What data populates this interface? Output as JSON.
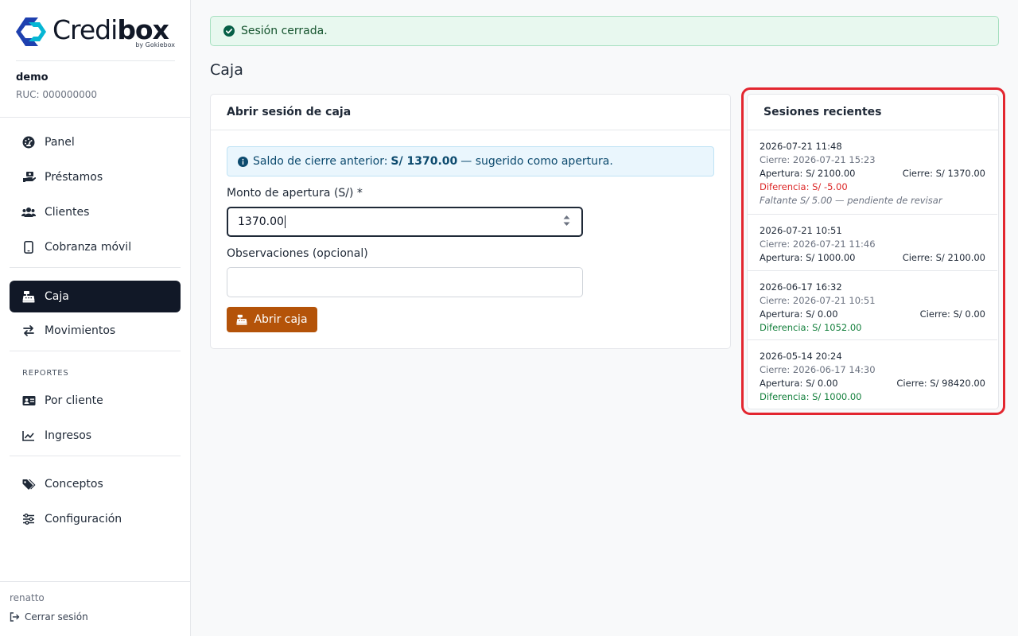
{
  "brand": {
    "name_light": "Credi",
    "name_bold": "box",
    "byline": "by Gokiebox"
  },
  "org": {
    "name": "demo",
    "ruc": "RUC: 000000000"
  },
  "nav": {
    "panel": "Panel",
    "loans": "Préstamos",
    "clients": "Clientes",
    "mobile": "Cobranza móvil",
    "cash": "Caja",
    "movements": "Movimientos",
    "reports_label": "REPORTES",
    "by_client": "Por cliente",
    "income": "Ingresos",
    "concepts": "Conceptos",
    "settings": "Configuración"
  },
  "user": {
    "name": "renatto",
    "logout": "Cerrar sesión"
  },
  "alert": {
    "message": "Sesión cerrada."
  },
  "page": {
    "title": "Caja"
  },
  "open_form": {
    "header": "Abrir sesión de caja",
    "info_prefix": "Saldo de cierre anterior:",
    "info_amount": "S/ 1370.00",
    "info_suffix": "— sugerido como apertura.",
    "amount_label": "Monto de apertura (S/) *",
    "amount_value": "1370.00",
    "notes_label": "Observaciones (opcional)",
    "notes_value": "",
    "submit": "Abrir caja"
  },
  "sessions": {
    "header": "Sesiones recientes",
    "items": [
      {
        "opened": "2026-07-21 11:48",
        "closed": "Cierre: 2026-07-21 15:23",
        "apertura": "Apertura: S/ 2100.00",
        "cierre": "Cierre: S/ 1370.00",
        "diff": "Diferencia: S/ -5.00",
        "note": "Faltante S/ 5.00 — pendiente de revisar"
      },
      {
        "opened": "2026-07-21 10:51",
        "closed": "Cierre: 2026-07-21 11:46",
        "apertura": "Apertura: S/ 1000.00",
        "cierre": "Cierre: S/ 2100.00"
      },
      {
        "opened": "2026-06-17 16:32",
        "closed": "Cierre: 2026-07-21 10:51",
        "apertura": "Apertura: S/ 0.00",
        "cierre": "Cierre: S/ 0.00",
        "diff": "Diferencia: S/ 1052.00"
      },
      {
        "opened": "2026-05-14 20:24",
        "closed": "Cierre: 2026-06-17 14:30",
        "apertura": "Apertura: S/ 0.00",
        "cierre": "Cierre: S/ 98420.00",
        "diff": "Diferencia: S/ 1000.00"
      }
    ]
  },
  "colors": {
    "brand_blue": "#1e40af",
    "brand_cyan": "#06b6d4",
    "accent": "#b45309",
    "highlight": "#e3262f",
    "negative": "#dc2626",
    "positive": "#15803d"
  }
}
